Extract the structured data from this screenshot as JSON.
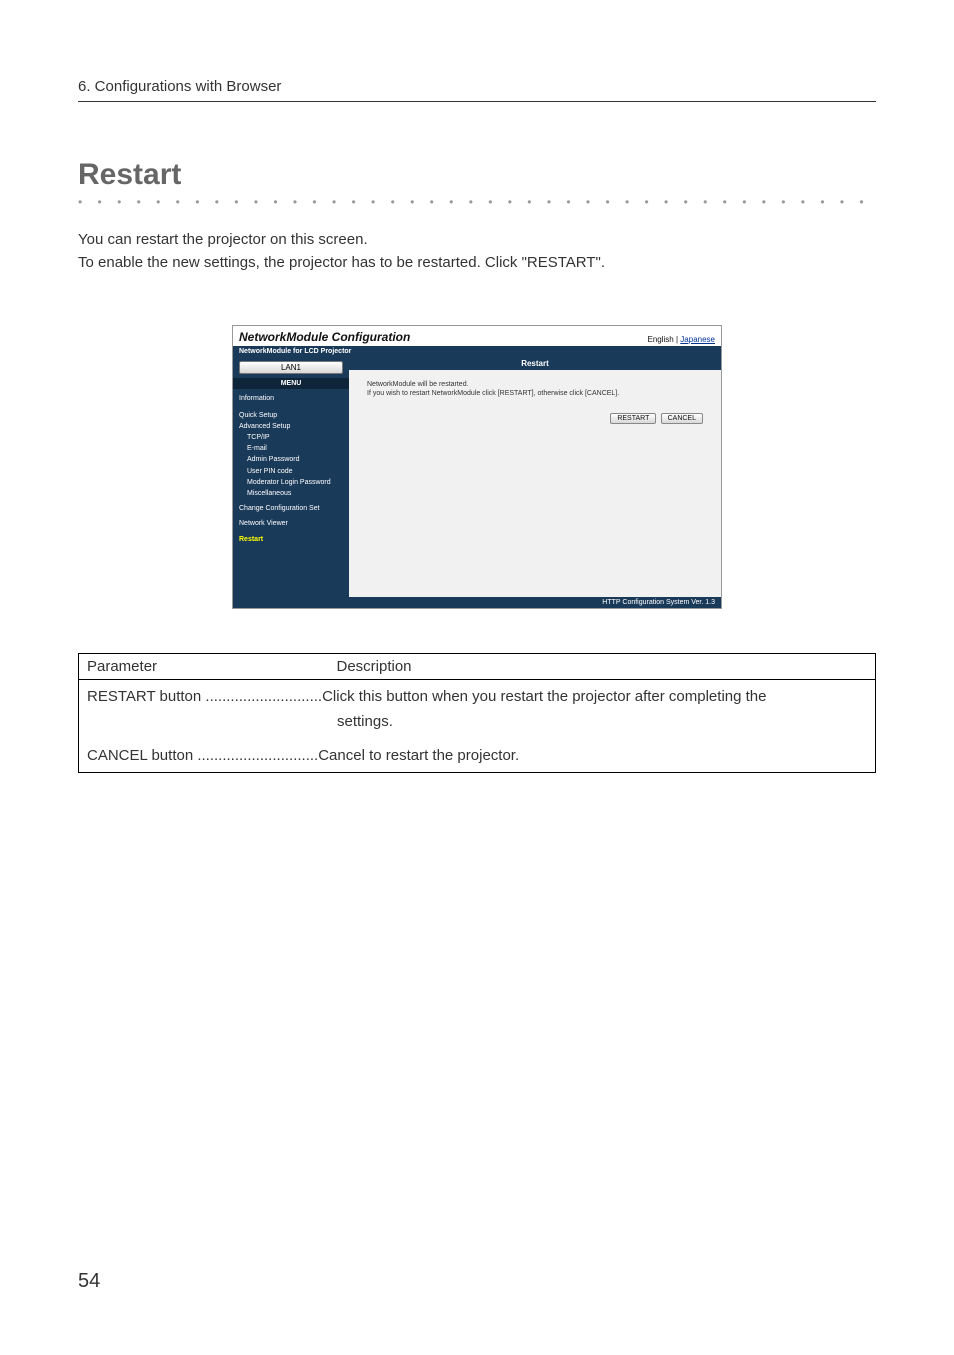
{
  "chapter_heading": "6. Configurations with Browser",
  "section_title": "Restart",
  "dot_separator": "• • • • • • • • • • • • • • • • • • • • • • • • • • • • • • • • • • • • • • • • • • • • • • • • • • • • • • • • • • • • • • • •",
  "body_para_1": "You can restart the projector on this screen.",
  "body_para_2": "To enable the new settings, the projector has to be restarted. Click \"RESTART\".",
  "screenshot": {
    "window_title": "NetworkModule Configuration",
    "lang_text_prefix": "English |",
    "lang_link": "Japanese",
    "subheader": "NetworkModule for LCD Projector",
    "lan_button": "LAN1",
    "menu_label": "MENU",
    "sidebar": [
      "Information",
      "Quick Setup",
      "Advanced Setup",
      "TCP/IP",
      "E-mail",
      "Admin Password",
      "User PIN code",
      "Moderator Login Password",
      "Miscellaneous",
      "Change Configuration Set",
      "Network Viewer",
      "Restart"
    ],
    "main_title": "Restart",
    "msg_line_1": "NetworkModule will be restarted.",
    "msg_line_2": "If you wish to restart NetworkModule click [RESTART], otherwise click [CANCEL].",
    "btn_restart": "RESTART",
    "btn_cancel": "CANCEL",
    "footer": "HTTP Configuration System Ver. 1.3"
  },
  "table": {
    "header_param": "Parameter",
    "header_desc": "Description",
    "rows": [
      {
        "param": "RESTART button",
        "leader": " ............................",
        "desc_line1": "Click this button when you restart the projector after completing the",
        "desc_line2": "settings."
      },
      {
        "param": "CANCEL button",
        "leader": "  .............................",
        "desc_line1": "Cancel to restart the projector.",
        "desc_line2": ""
      }
    ]
  },
  "page_number": "54"
}
